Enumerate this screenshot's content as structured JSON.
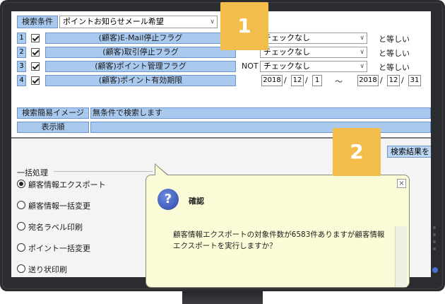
{
  "search_conditions": {
    "label": "検索条件",
    "preset_value": "ポイントお知らせメール希望",
    "rows": [
      {
        "num": "1",
        "field": "(顧客)E-Mail停止フラグ",
        "not": "",
        "value": "チェックなし",
        "operator": "と等しい"
      },
      {
        "num": "2",
        "field": "(顧客)取引停止フラグ",
        "not": "",
        "value": "チェックなし",
        "operator": "と等しい"
      },
      {
        "num": "3",
        "field": "(顧客)ポイント管理フラグ",
        "not": "NOT",
        "value": "チェックなし",
        "operator": "と等しい"
      },
      {
        "num": "4",
        "field": "(顧客)ポイント有効期限",
        "not": ""
      }
    ],
    "date_range": {
      "from": {
        "year": "2018",
        "month": "12",
        "day": "1"
      },
      "to": {
        "year": "2018",
        "month": "12",
        "day": "31"
      },
      "sep": "/",
      "tilde": "〜"
    },
    "image_label": "検索簡易イメージ",
    "image_value": "無条件で検索します",
    "order_label": "表示順",
    "order_value": ""
  },
  "search_button": "検索結果を",
  "bulk": {
    "title": "一括処理",
    "options": [
      {
        "label": "顧客情報エクスポート",
        "selected": true
      },
      {
        "label": "顧客情報一括変更",
        "selected": false
      },
      {
        "label": "宛名ラベル印刷",
        "selected": false
      },
      {
        "label": "ポイント一括変更",
        "selected": false
      },
      {
        "label": "送り状印刷",
        "selected": false
      }
    ]
  },
  "dialog": {
    "title": "確認",
    "message": "顧客情報エクスポートの対象件数が6583件ありますが顧客情報エクスポートを実行しますか？",
    "close": "×",
    "icon": "question-icon"
  },
  "badges": [
    "1",
    "2"
  ],
  "colors": {
    "badge": "#f2bd4a",
    "label_bg": "#a9c9ef",
    "dialog_bg": "#fbfbd7",
    "bezel": "#2a2c30"
  }
}
